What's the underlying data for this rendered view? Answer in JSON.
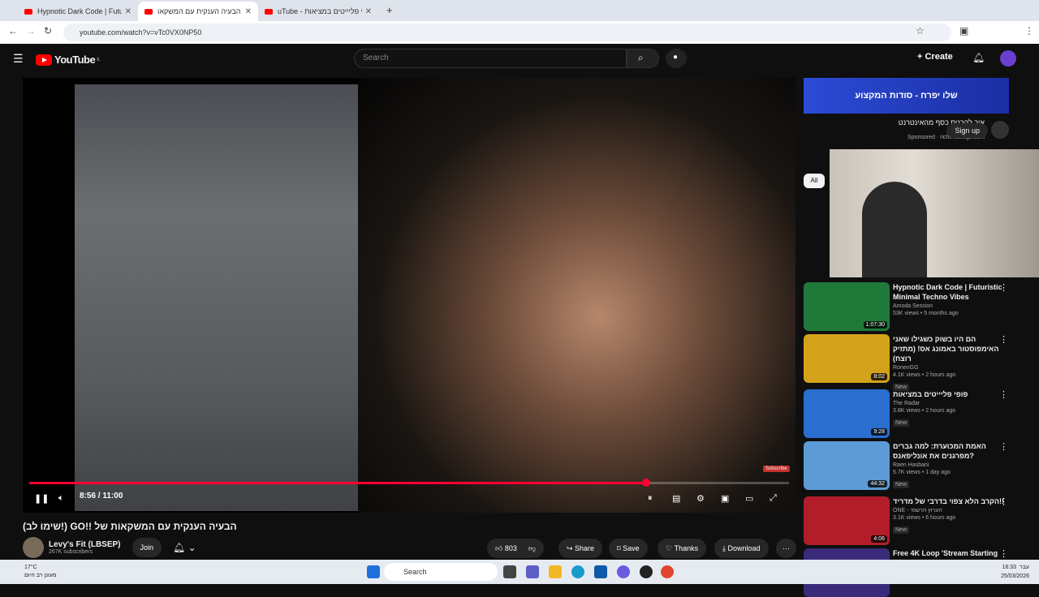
{
  "browser": {
    "tabs": [
      {
        "label": "Hypnotic Dark Code | Futuristic",
        "active": false
      },
      {
        "label": "הבעיה הענקית עם המשקאו",
        "active": true
      },
      {
        "label": "uTube - פופי פליייטים במציאות",
        "active": false
      }
    ],
    "url": "youtube.com/watch?v=vTc0VX0NP50"
  },
  "youtube": {
    "logo": "YouTube",
    "logo_region": "IL",
    "search_placeholder": "Search",
    "create_label": "Create"
  },
  "player": {
    "time": "8:56 / 11:00",
    "progress_fraction": 0.8121,
    "subscribe_tag": "Subscribe"
  },
  "video": {
    "title": "(שימו לב!) GO!! הבעיה הענקית עם המשקאות של",
    "channel": "Levy's Fit (LBSEP)",
    "subscribers": "267K subscribers",
    "join_label": "Join",
    "likes": "803",
    "share_label": "Share",
    "save_label": "Save",
    "thanks_label": "Thanks",
    "download_label": "Download"
  },
  "ad": {
    "banner": "שלו יפרח - סודות המקצוע",
    "title": "איך להכניס כסף מהאינטרנט ב2026",
    "sponsored": "Sponsored",
    "domain": "richercollege.com",
    "signup_label": "Sign up"
  },
  "filter_chip": "All",
  "sidebar": [
    {
      "title": "Hypnotic Dark Code | Futuristic Minimal Techno Vibes",
      "channel": "Amoda Session",
      "meta": "53K views • 5 months ago",
      "duration": "1:07:30",
      "new": false,
      "color": "#1f7a3a"
    },
    {
      "title": "הם היו בשוק כשגילו שאני האימפוסטור באמונג אס! (מתזיק רוצח)",
      "channel": "RonenGG",
      "meta": "4.1K views • 2 hours ago",
      "duration": "8:02",
      "new": true,
      "color": "#d4a21a"
    },
    {
      "title": "פופי פליייטים במציאות",
      "channel": "The Radar",
      "meta": "3.8K views • 2 hours ago",
      "duration": "9:28",
      "new": true,
      "color": "#2a6fd0"
    },
    {
      "title": "האמת המכוערת: למה גברים מפרגנים את אונליפאנס?",
      "channel": "Raen Hasbani",
      "meta": "5.7K views • 1 day ago",
      "duration": "44:32",
      "new": true,
      "color": "#5d9bd6"
    },
    {
      "title": "הקרב הלא צפוי בדרבי של מדריד!!",
      "channel": "ONE - הערוץ הרשמי",
      "meta": "3.1K views • 6 hours ago",
      "duration": "4:06",
      "new": true,
      "color": "#b21d2a"
    },
    {
      "title": "Free 4K Loop 'Stream Starting",
      "channel": "",
      "meta": "",
      "duration": "",
      "new": false,
      "color": "#3a2a7a"
    }
  ],
  "taskbar": {
    "search_label": "Search",
    "weather_temp": "17°C",
    "weather_desc": "מעונן רב היום",
    "time": "16:33",
    "date": "25/03/2026",
    "lang": "עבר"
  }
}
